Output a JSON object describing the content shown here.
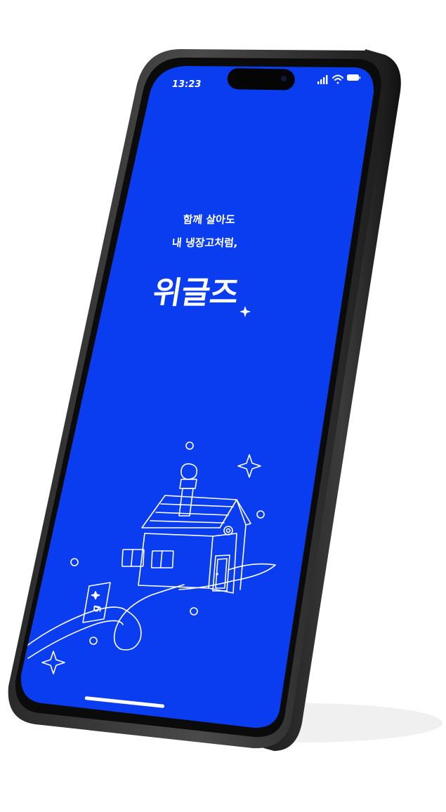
{
  "status_bar": {
    "time": "13:23"
  },
  "splash": {
    "tagline_line1": "함께 살아도",
    "tagline_line2": "내 냉장고처럼,",
    "brand_name": "위글즈"
  },
  "icons": {
    "signal": "cellular-signal-icon",
    "wifi": "wifi-icon",
    "battery": "battery-icon"
  },
  "colors": {
    "screen_background": "#0a3df0",
    "illustration_line": "#ffffff",
    "device_frame": "#1f1f1f"
  }
}
